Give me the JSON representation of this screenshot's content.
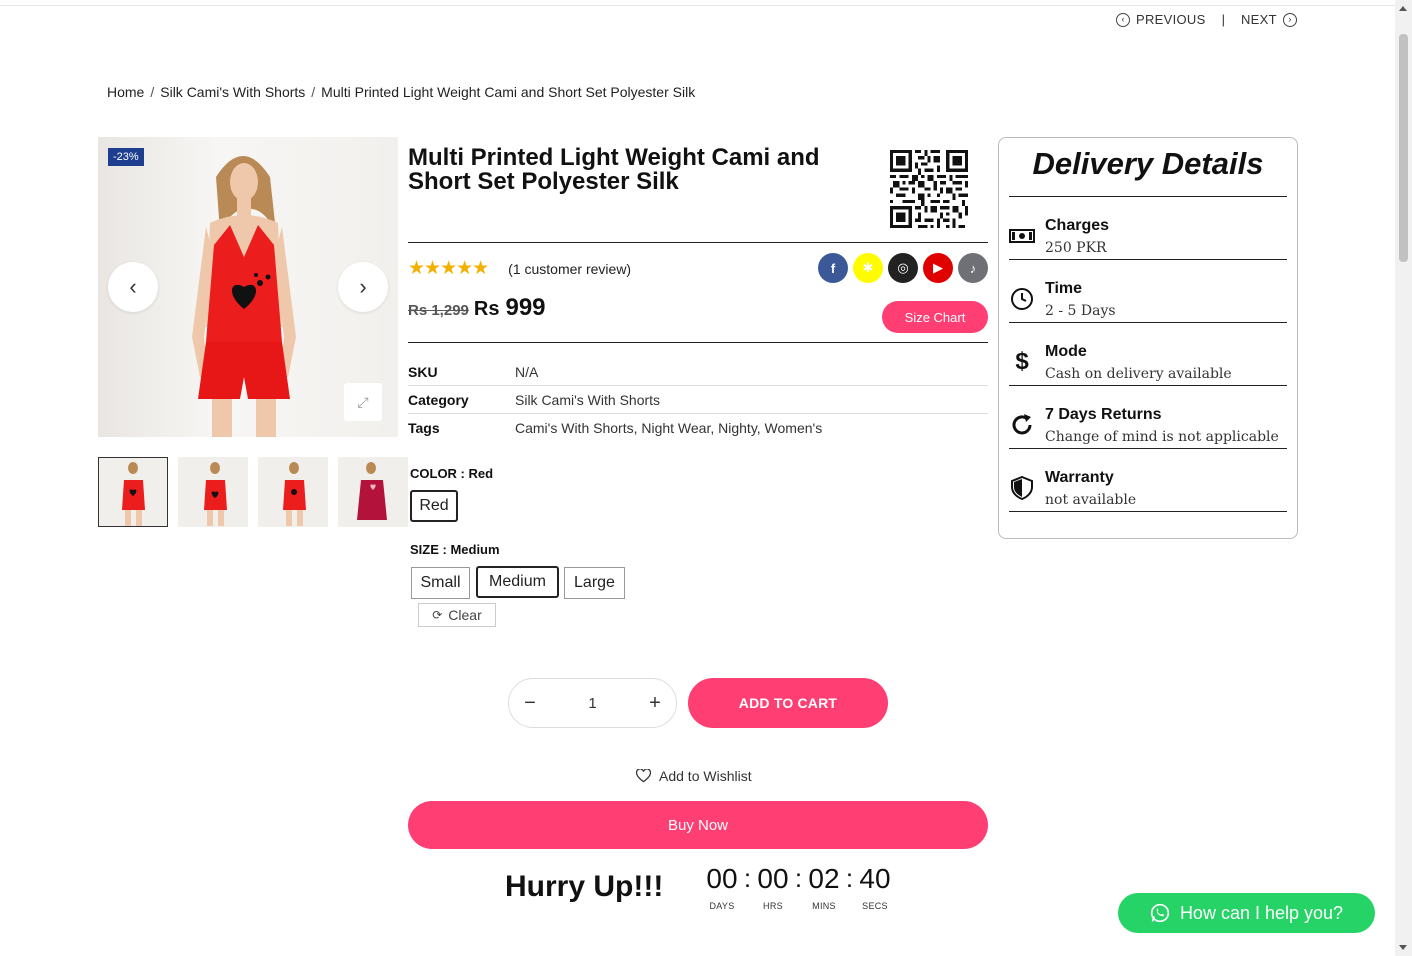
{
  "nav": {
    "previous": "PREVIOUS",
    "separator": "|",
    "next": "NEXT"
  },
  "breadcrumb": {
    "home": "Home",
    "category": "Silk Cami's With Shorts",
    "current": "Multi Printed Light Weight Cami and Short Set Polyester Silk",
    "sep": "/"
  },
  "gallery": {
    "badge": "-23%",
    "thumb_count": 4
  },
  "product": {
    "title": "Multi Printed Light Weight Cami and Short Set Polyester Silk",
    "stars": "★★★★★",
    "rating": 5,
    "reviews": "(1 customer review)",
    "old_price": "Rs 1,299",
    "currency": "Rs",
    "price": "999",
    "size_chart": "Size Chart"
  },
  "socials": [
    {
      "name": "facebook-icon",
      "color": "#3b5998",
      "glyph": "f"
    },
    {
      "name": "snapchat-icon",
      "color": "#fffc00",
      "glyph": "✱"
    },
    {
      "name": "instagram-icon",
      "color": "#222222",
      "glyph": "◎"
    },
    {
      "name": "youtube-icon",
      "color": "#e00000",
      "glyph": "▶"
    },
    {
      "name": "tiktok-icon",
      "color": "#6e7076",
      "glyph": "♪"
    }
  ],
  "meta": {
    "sku_label": "SKU",
    "sku": "N/A",
    "category_label": "Category",
    "category": "Silk Cami's With Shorts",
    "tags_label": "Tags",
    "tags": "Cami's With Shorts, Night Wear, Nighty, Women's"
  },
  "options": {
    "color_label": "COLOR : Red",
    "color_value": "Red",
    "size_label": "SIZE : Medium",
    "sizes": [
      "Small",
      "Medium",
      "Large"
    ],
    "selected_size": "Medium",
    "clear": "Clear"
  },
  "cart": {
    "quantity": "1",
    "minus": "−",
    "plus": "+",
    "add_to_cart": "ADD TO CART",
    "wishlist": "Add to Wishlist",
    "buy_now": "Buy Now"
  },
  "countdown": {
    "hurry": "Hurry Up!!!",
    "days": "00",
    "hrs": "00",
    "mins": "02",
    "secs": "40",
    "days_label": "DAYS",
    "hrs_label": "HRS",
    "mins_label": "MINS",
    "secs_label": "SECS"
  },
  "delivery": {
    "title": "Delivery Details",
    "items": [
      {
        "heading": "Charges",
        "text": "250 PKR"
      },
      {
        "heading": "Time",
        "text": "2 - 5 Days"
      },
      {
        "heading": "Mode",
        "text": "Cash on delivery available"
      },
      {
        "heading": "7 Days Returns",
        "text": "Change of mind is not applicable"
      },
      {
        "heading": "Warranty",
        "text": "not available"
      }
    ]
  },
  "chat": {
    "label": "How can I help you?"
  },
  "colors": {
    "accent": "#ff3f74",
    "whatsapp": "#25d366",
    "badge": "#1e3f8f",
    "star": "#f2b100"
  }
}
